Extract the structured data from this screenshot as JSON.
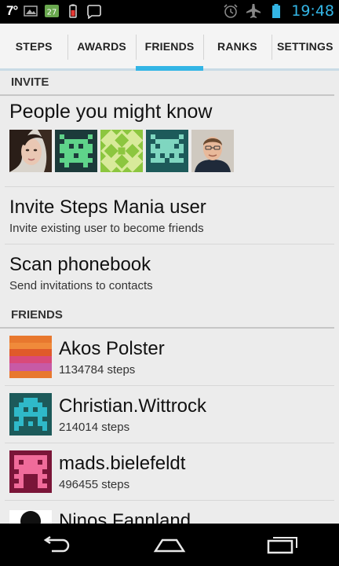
{
  "status_bar": {
    "temperature": "7°",
    "notification_badge": "27",
    "time": "19:48",
    "colors": {
      "clock": "#33b5e5",
      "badge": "#6aa84f"
    },
    "icons": [
      "image-icon",
      "calendar-badge-icon",
      "battery-alert-icon",
      "speech-bubble-icon",
      "alarm-icon",
      "airplane-icon",
      "battery-icon"
    ]
  },
  "tabs": [
    {
      "label": "STEPS",
      "active": false
    },
    {
      "label": "AWARDS",
      "active": false
    },
    {
      "label": "FRIENDS",
      "active": true
    },
    {
      "label": "RANKS",
      "active": false
    },
    {
      "label": "SETTINGS",
      "active": false
    }
  ],
  "invite": {
    "header": "INVITE",
    "people_title": "People you might know",
    "avatars": [
      "photo-woman",
      "green-pixel-invader",
      "green-pattern",
      "teal-pixel-invader",
      "photo-man"
    ],
    "invite_user": {
      "title": "Invite Steps Mania user",
      "subtitle": "Invite existing user to become friends"
    },
    "scan": {
      "title": "Scan phonebook",
      "subtitle": "Send invitations to contacts"
    }
  },
  "friends": {
    "header": "FRIENDS",
    "items": [
      {
        "name": "Akos Polster",
        "steps": "1134784 steps",
        "avatar": "striped-orange-pink"
      },
      {
        "name": "Christian.Wittrock",
        "steps": "214014 steps",
        "avatar": "teal-cyan-invader"
      },
      {
        "name": "mads.bielefeldt",
        "steps": "496455 steps",
        "avatar": "pink-invader"
      },
      {
        "name": "Ninos Fannland",
        "avatar": "black-circle"
      }
    ]
  },
  "accent_color": "#33b5e5"
}
